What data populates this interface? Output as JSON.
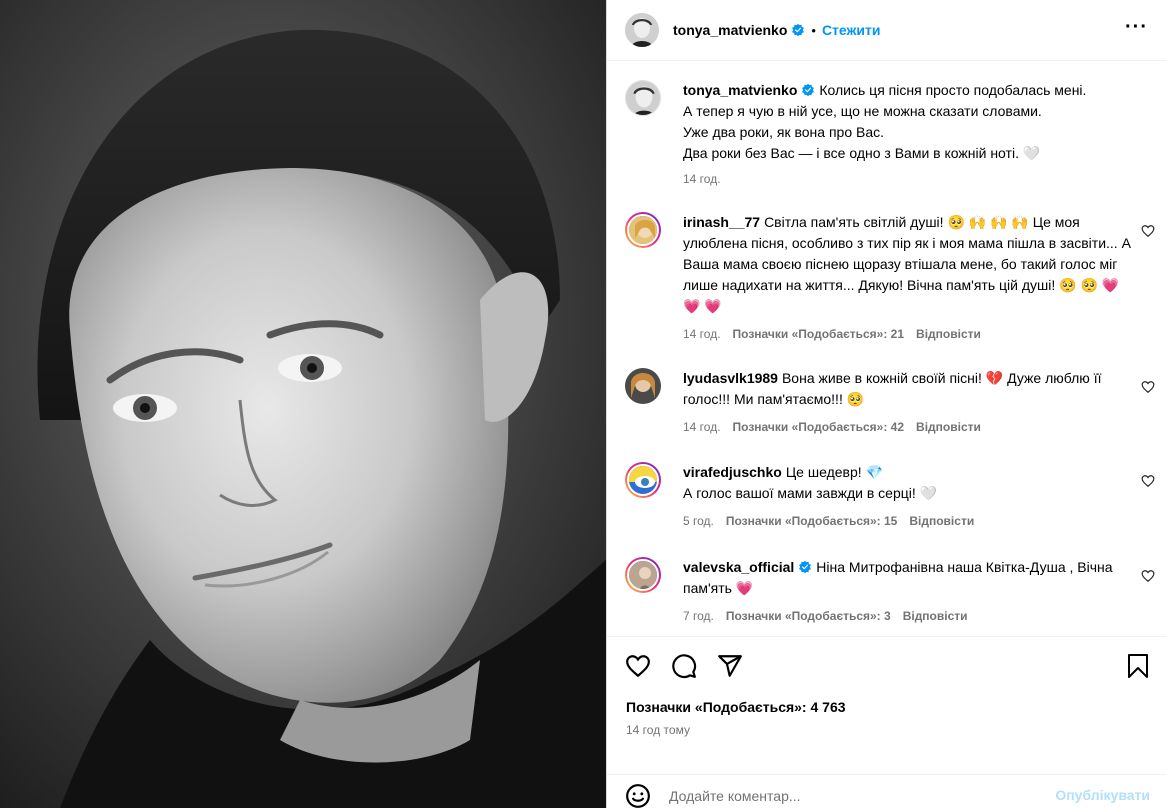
{
  "post": {
    "author": "tonya_matvienko",
    "follow_label": "Стежити",
    "separator": "•",
    "more_label": "···"
  },
  "caption": {
    "user": "tonya_matvienko",
    "lines": [
      "Колись ця пісня просто подобалась мені.",
      "А тепер я чую в ній усе, що не можна сказати словами.",
      "Уже два роки, як вона про Вас.",
      "Два роки без Вас — і все одно з Вами в кожній ноті. 🤍"
    ],
    "time": "14 год."
  },
  "comments": [
    {
      "user": "irinash__77",
      "text": "Світла пам'ять світлій душі! 🥺 🙌 🙌 🙌  Це моя улюблена пісня, особливо з тих пір як і моя мама пішла в засвіти... А Ваша мама своєю піснею щоразу втішала мене, бо такий голос міг лише надихати на життя... Дякую! Вічна пам'ять цій душі! 🥺 🥺 💗 💗 💗",
      "time": "14 год.",
      "likes": "Позначки «Подобається»: 21",
      "reply": "Відповісти"
    },
    {
      "user": "lyudasvlk1989",
      "text": "Вона живе в кожній своїй пісні! 💔  Дуже люблю її голос!!! Ми пам'ятаємо!!! 🥺",
      "time": "14 год.",
      "likes": "Позначки «Подобається»: 42",
      "reply": "Відповісти"
    },
    {
      "user": "virafedjuschko",
      "text_line1": "Це шедевр! 💎",
      "text_line2": "А голос вашої мами завжди в серці! 🤍",
      "time": "5 год.",
      "likes": "Позначки «Подобається»: 15",
      "reply": "Відповісти"
    },
    {
      "user": "valevska_official",
      "text": "Ніна Митрофанівна наша Квітка-Душа , Вічна пам'ять 💗",
      "time": "7 год.",
      "likes": "Позначки «Подобається»: 3",
      "reply": "Відповісти"
    }
  ],
  "footer": {
    "likes_total": "Позначки «Подобається»: 4 763",
    "time_ago": "14 год тому",
    "comment_placeholder": "Додайте коментар...",
    "publish_label": "Опублікувати"
  },
  "icons": {
    "like": "heart-icon",
    "comment": "comment-icon",
    "share": "share-icon",
    "save": "bookmark-icon",
    "emoji": "emoji-icon",
    "verified": "verified-badge-icon"
  },
  "colors": {
    "link": "#0095f6",
    "muted": "#737373",
    "verified": "#0095f6",
    "publish_disabled": "#b2dffc"
  }
}
